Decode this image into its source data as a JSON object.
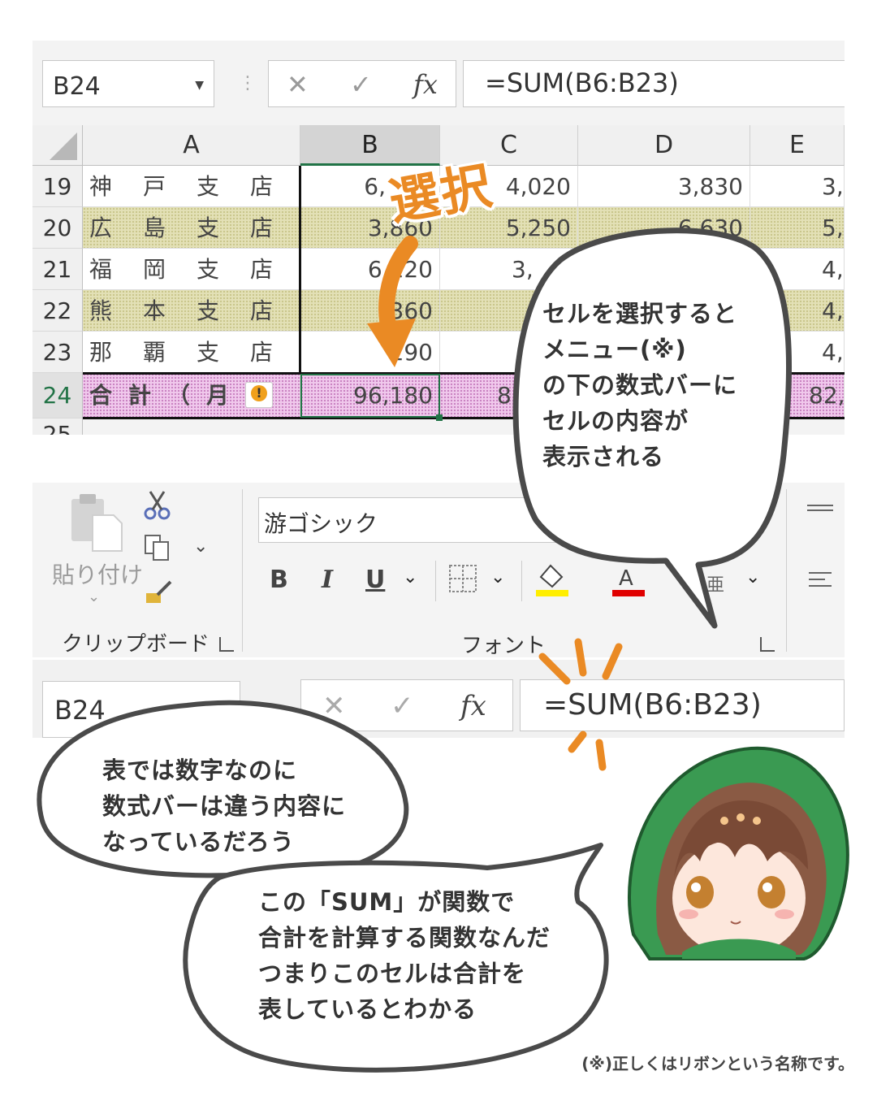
{
  "top_screenshot": {
    "name_box": "B24",
    "formula_buttons": {
      "cancel": "✕",
      "enter": "✓",
      "fx": "fx"
    },
    "formula": "=SUM(B6:B23)",
    "columns": [
      "A",
      "B",
      "C",
      "D",
      "E"
    ],
    "rows": [
      {
        "num": "19",
        "name": "神戸支店",
        "b": "6,",
        "c": "4,020",
        "d": "3,830",
        "e": "3,"
      },
      {
        "num": "20",
        "name": "広島支店",
        "b": "3,860",
        "c": "5,250",
        "d": "6,630",
        "e": "5,"
      },
      {
        "num": "21",
        "name": "福岡支店",
        "b": "6,120",
        "c": "3,",
        "d": "",
        "e": "4,"
      },
      {
        "num": "22",
        "name": "熊本支店",
        "b": "360",
        "c": "",
        "d": "",
        "e": "4,"
      },
      {
        "num": "23",
        "name": "那覇支店",
        "b": "190",
        "c": "",
        "d": "",
        "e": "4,"
      },
      {
        "num": "24",
        "name": "合計（月",
        "b": "96,180",
        "c": "8",
        "d": "",
        "e": "82,"
      },
      {
        "num": "25",
        "name": "",
        "b": "",
        "c": "",
        "d": "",
        "e": ""
      }
    ],
    "select_label": "選択"
  },
  "ribbon": {
    "paste_label": "貼り付け",
    "clipboard_label": "クリップボード",
    "font_name": "游ゴシック",
    "font_group_label": "フォント",
    "bold": "B",
    "italic": "I",
    "underline": "U",
    "dropdown": "⌄",
    "ruby": "亜",
    "highlight_color": "#ffee00",
    "font_color": "#e00000"
  },
  "bottom_formula_bar": {
    "name_box": "B24",
    "formula": "=SUM(B6:B23)"
  },
  "bubbles": {
    "right": "セルを選択すると\nメニュー(※)\nの下の数式バーに\nセルの内容が\n表示される",
    "left": "表では数字なのに\n数式バーは違う内容に\nなっているだろう",
    "bottom": "この「SUM」が関数で\n合計を計算する関数なんだ\nつまりこのセルは合計を\n表しているとわかる"
  },
  "footnote": "(※)正しくはリボンという名称です。",
  "colors": {
    "accent_orange": "#ea8a24",
    "excel_green": "#217346",
    "hood_green": "#3a9a52"
  }
}
